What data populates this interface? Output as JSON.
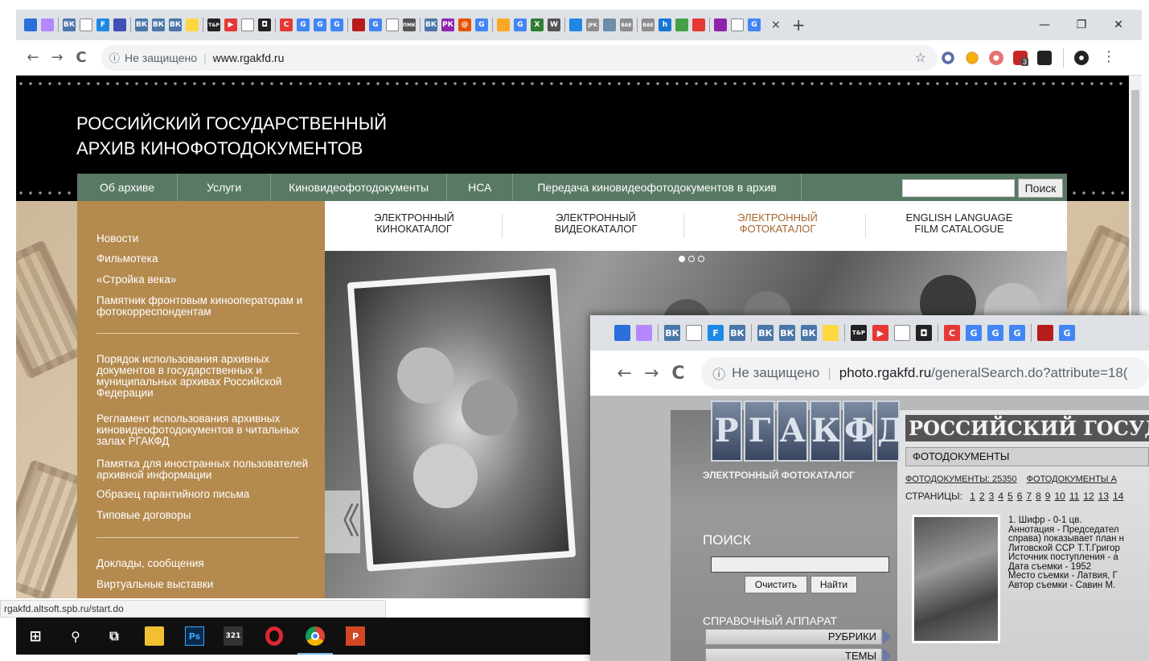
{
  "browser1": {
    "tab_close": "×",
    "new_tab": "+",
    "window_controls": [
      "—",
      "❐",
      "✕"
    ],
    "nav": {
      "back": "←",
      "forward": "→",
      "reload": "C"
    },
    "address": {
      "security_label": "Не защищено",
      "url": "www.rgakfd.ru"
    },
    "bookmark_star": "☆",
    "ext_badge": "3",
    "menu": "⋮",
    "favicon_labels": [
      "",
      "",
      "ВК",
      "",
      "F",
      "",
      "ВК",
      "ВК",
      "ВК",
      "",
      "T&P",
      "▶",
      "",
      "◘",
      "C",
      "G",
      "G",
      "G",
      "",
      "G",
      "",
      "ПМК",
      "ВК",
      "РК",
      "@",
      "G",
      "",
      "G",
      "X",
      "W",
      "",
      "JFK",
      "",
      "ВАЕ",
      "ВАЕ",
      "h",
      "",
      "",
      "",
      "",
      "G"
    ]
  },
  "site": {
    "title_line1": "РОССИЙСКИЙ ГОСУДАРСТВЕННЫЙ",
    "title_line2": "АРХИВ КИНОФОТОДОКУМЕНТОВ",
    "nav": [
      "Об архиве",
      "Услуги",
      "Киновидеофотодокументы",
      "НСА",
      "Передача киновидеофотодокументов в архив"
    ],
    "search_button": "Поиск",
    "sidebar": {
      "group1": [
        "Новости",
        "Фильмотека",
        "«Стройка века»",
        "Памятник фронтовым кинооператорам и фотокорреспондентам"
      ],
      "group2": [
        "Порядок использования архивных документов в государственных и муниципальных архивах Российской Федерации",
        "Регламент использования архивных киновидеофотодокументов в читальных залах РГАКФД",
        "Памятка для иностранных пользователей архивной информации",
        "Образец гарантийного письма",
        "Типовые договоры"
      ],
      "group3": [
        "Доклады, сообщения",
        "Виртуальные выставки"
      ]
    },
    "catalogs": [
      {
        "line1": "ЭЛЕКТРОННЫЙ",
        "line2": "КИНОКАТАЛОГ"
      },
      {
        "line1": "ЭЛЕКТРОННЫЙ",
        "line2": "ВИДЕОКАТАЛОГ"
      },
      {
        "line1": "ЭЛЕКТРОННЫЙ",
        "line2": "ФОТОКАТАЛОГ"
      },
      {
        "line1": "ENGLISH LANGUAGE",
        "line2": "FILM CATALOGUE"
      }
    ],
    "active_catalog_index": 2,
    "slider_prev": "《",
    "colors": {
      "nav_green": "#587a64",
      "sidebar_brown": "#b48a4f",
      "active_catalog": "#a7672e"
    }
  },
  "status_bar": "rgakfd.altsoft.spb.ru/start.do",
  "taskbar": {
    "start": "⊞",
    "search": "⚲",
    "taskview": "⧉",
    "apps": [
      "explorer-icon",
      "photoshop-icon",
      "calendar-icon",
      "opera-icon",
      "chrome-icon",
      "powerpoint-icon"
    ],
    "ps_label": "Ps",
    "cal_label": "321",
    "ppt_label": "P"
  },
  "browser2": {
    "address": {
      "security_label": "Не защищено",
      "host": "photo.rgakfd.ru",
      "path": "/generalSearch.do?attribute=18("
    },
    "favicon_labels": [
      "",
      "",
      "ВК",
      "",
      "F",
      "ВК",
      "ВК",
      "ВК",
      "ВК",
      "",
      "T&P",
      "▶",
      "",
      "◘",
      "C",
      "G",
      "G",
      "G",
      "",
      "G"
    ]
  },
  "photo_site": {
    "logo_letters": [
      "Р",
      "Г",
      "А",
      "К",
      "Ф",
      "Д"
    ],
    "catalog_title": "ЭЛЕКТРОННЫЙ ФОТОКАТАЛОГ",
    "big_title": "РОССИЙСКИЙ ГОСУДАРСТВЕН",
    "section_label": "ФОТОДОКУМЕНТЫ",
    "counts_line": "ФОТОДОКУМЕНТЫ: 25350",
    "counts_line2": "ФОТОДОКУМЕНТЫ А",
    "pages_label": "СТРАНИЦЫ:",
    "pages": [
      "1",
      "2",
      "3",
      "4",
      "5",
      "6",
      "7",
      "8",
      "9",
      "10",
      "11",
      "12",
      "13",
      "14"
    ],
    "search_heading": "ПОИСК",
    "clear_button": "Очистить",
    "find_button": "Найти",
    "reference_heading": "СПРАВОЧНЫЙ АППАРАТ",
    "rubrics": "РУБРИКИ",
    "topics": "ТЕМЫ",
    "record": [
      "1. Шифр  -  0-1 цв.",
      "Аннотация  -  Председател",
      "справа) показывает план н",
      "Литовской ССР Т.Т.Григор",
      "Источник поступления  -  а",
      "Дата съемки  -  1952",
      "Место съемки  -  Латвия, Г",
      "Автор съемки  -  Савин М."
    ]
  }
}
